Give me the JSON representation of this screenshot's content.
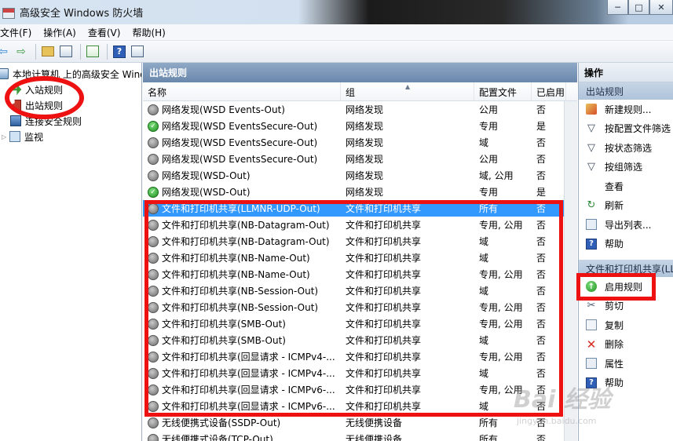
{
  "window": {
    "title": "高级安全 Windows 防火墙",
    "minimize": "─",
    "maximize": "□",
    "close": "✕"
  },
  "menu": [
    "文件(F)",
    "操作(A)",
    "查看(V)",
    "帮助(H)"
  ],
  "toolbar": {
    "back": "⇦",
    "forward": "⇨",
    "help": "?"
  },
  "tree": {
    "root": "本地计算机 上的高级安全 Windows 防火墙",
    "items": [
      "入站规则",
      "出站规则",
      "连接安全规则",
      "监视"
    ]
  },
  "center": {
    "header": "出站规则",
    "columns": [
      "名称",
      "组",
      "配置文件",
      "已启用"
    ],
    "rows": [
      {
        "name": "网络发现(WSD Events-Out)",
        "group": "网络发现",
        "profile": "公用",
        "enabled": "否",
        "status": "off"
      },
      {
        "name": "网络发现(WSD EventsSecure-Out)",
        "group": "网络发现",
        "profile": "专用",
        "enabled": "是",
        "status": "on"
      },
      {
        "name": "网络发现(WSD EventsSecure-Out)",
        "group": "网络发现",
        "profile": "域",
        "enabled": "否",
        "status": "off"
      },
      {
        "name": "网络发现(WSD EventsSecure-Out)",
        "group": "网络发现",
        "profile": "公用",
        "enabled": "否",
        "status": "off"
      },
      {
        "name": "网络发现(WSD-Out)",
        "group": "网络发现",
        "profile": "域, 公用",
        "enabled": "否",
        "status": "off"
      },
      {
        "name": "网络发现(WSD-Out)",
        "group": "网络发现",
        "profile": "专用",
        "enabled": "是",
        "status": "on"
      },
      {
        "name": "文件和打印机共享(LLMNR-UDP-Out)",
        "group": "文件和打印机共享",
        "profile": "所有",
        "enabled": "否",
        "status": "off",
        "selected": true
      },
      {
        "name": "文件和打印机共享(NB-Datagram-Out)",
        "group": "文件和打印机共享",
        "profile": "专用, 公用",
        "enabled": "否",
        "status": "off"
      },
      {
        "name": "文件和打印机共享(NB-Datagram-Out)",
        "group": "文件和打印机共享",
        "profile": "域",
        "enabled": "否",
        "status": "off"
      },
      {
        "name": "文件和打印机共享(NB-Name-Out)",
        "group": "文件和打印机共享",
        "profile": "域",
        "enabled": "否",
        "status": "off"
      },
      {
        "name": "文件和打印机共享(NB-Name-Out)",
        "group": "文件和打印机共享",
        "profile": "专用, 公用",
        "enabled": "否",
        "status": "off"
      },
      {
        "name": "文件和打印机共享(NB-Session-Out)",
        "group": "文件和打印机共享",
        "profile": "域",
        "enabled": "否",
        "status": "off"
      },
      {
        "name": "文件和打印机共享(NB-Session-Out)",
        "group": "文件和打印机共享",
        "profile": "专用, 公用",
        "enabled": "否",
        "status": "off"
      },
      {
        "name": "文件和打印机共享(SMB-Out)",
        "group": "文件和打印机共享",
        "profile": "专用, 公用",
        "enabled": "否",
        "status": "off"
      },
      {
        "name": "文件和打印机共享(SMB-Out)",
        "group": "文件和打印机共享",
        "profile": "域",
        "enabled": "否",
        "status": "off"
      },
      {
        "name": "文件和打印机共享(回显请求 - ICMPv4-...",
        "group": "文件和打印机共享",
        "profile": "专用, 公用",
        "enabled": "否",
        "status": "off"
      },
      {
        "name": "文件和打印机共享(回显请求 - ICMPv4-...",
        "group": "文件和打印机共享",
        "profile": "域",
        "enabled": "否",
        "status": "off"
      },
      {
        "name": "文件和打印机共享(回显请求 - ICMPv6-...",
        "group": "文件和打印机共享",
        "profile": "专用, 公用",
        "enabled": "否",
        "status": "off"
      },
      {
        "name": "文件和打印机共享(回显请求 - ICMPv6-...",
        "group": "文件和打印机共享",
        "profile": "域",
        "enabled": "否",
        "status": "off"
      },
      {
        "name": "无线便携式设备(SSDP-Out)",
        "group": "无线便携设备",
        "profile": "所有",
        "enabled": "否",
        "status": "off"
      },
      {
        "name": "无线便携式设备(TCP-Out)",
        "group": "无线便携设备",
        "profile": "所有",
        "enabled": "否",
        "status": "off"
      }
    ]
  },
  "actions": {
    "header": "操作",
    "section1": "出站规则",
    "items1": [
      "新建规则...",
      "按配置文件筛选",
      "按状态筛选",
      "按组筛选",
      "查看",
      "刷新",
      "导出列表...",
      "帮助"
    ],
    "section2": "文件和打印机共享(LLMNR-UDP-Out)",
    "items2": [
      "启用规则",
      "剪切",
      "复制",
      "删除",
      "属性",
      "帮助"
    ]
  },
  "watermark": {
    "text": "Bai 经验",
    "sub": "jingyan.baidu.com"
  },
  "colors": {
    "selection": "#3399ff",
    "annotation": "#ee1111",
    "pane_header": "#7f9bbd"
  }
}
